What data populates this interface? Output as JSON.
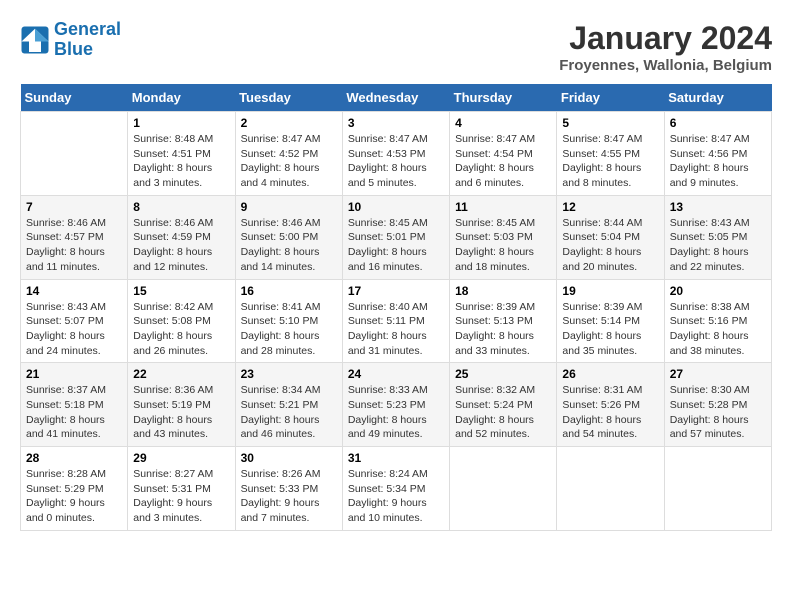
{
  "header": {
    "logo_line1": "General",
    "logo_line2": "Blue",
    "month_year": "January 2024",
    "location": "Froyennes, Wallonia, Belgium"
  },
  "weekdays": [
    "Sunday",
    "Monday",
    "Tuesday",
    "Wednesday",
    "Thursday",
    "Friday",
    "Saturday"
  ],
  "weeks": [
    [
      {
        "day": "",
        "info": ""
      },
      {
        "day": "1",
        "info": "Sunrise: 8:48 AM\nSunset: 4:51 PM\nDaylight: 8 hours\nand 3 minutes."
      },
      {
        "day": "2",
        "info": "Sunrise: 8:47 AM\nSunset: 4:52 PM\nDaylight: 8 hours\nand 4 minutes."
      },
      {
        "day": "3",
        "info": "Sunrise: 8:47 AM\nSunset: 4:53 PM\nDaylight: 8 hours\nand 5 minutes."
      },
      {
        "day": "4",
        "info": "Sunrise: 8:47 AM\nSunset: 4:54 PM\nDaylight: 8 hours\nand 6 minutes."
      },
      {
        "day": "5",
        "info": "Sunrise: 8:47 AM\nSunset: 4:55 PM\nDaylight: 8 hours\nand 8 minutes."
      },
      {
        "day": "6",
        "info": "Sunrise: 8:47 AM\nSunset: 4:56 PM\nDaylight: 8 hours\nand 9 minutes."
      }
    ],
    [
      {
        "day": "7",
        "info": "Sunrise: 8:46 AM\nSunset: 4:57 PM\nDaylight: 8 hours\nand 11 minutes."
      },
      {
        "day": "8",
        "info": "Sunrise: 8:46 AM\nSunset: 4:59 PM\nDaylight: 8 hours\nand 12 minutes."
      },
      {
        "day": "9",
        "info": "Sunrise: 8:46 AM\nSunset: 5:00 PM\nDaylight: 8 hours\nand 14 minutes."
      },
      {
        "day": "10",
        "info": "Sunrise: 8:45 AM\nSunset: 5:01 PM\nDaylight: 8 hours\nand 16 minutes."
      },
      {
        "day": "11",
        "info": "Sunrise: 8:45 AM\nSunset: 5:03 PM\nDaylight: 8 hours\nand 18 minutes."
      },
      {
        "day": "12",
        "info": "Sunrise: 8:44 AM\nSunset: 5:04 PM\nDaylight: 8 hours\nand 20 minutes."
      },
      {
        "day": "13",
        "info": "Sunrise: 8:43 AM\nSunset: 5:05 PM\nDaylight: 8 hours\nand 22 minutes."
      }
    ],
    [
      {
        "day": "14",
        "info": "Sunrise: 8:43 AM\nSunset: 5:07 PM\nDaylight: 8 hours\nand 24 minutes."
      },
      {
        "day": "15",
        "info": "Sunrise: 8:42 AM\nSunset: 5:08 PM\nDaylight: 8 hours\nand 26 minutes."
      },
      {
        "day": "16",
        "info": "Sunrise: 8:41 AM\nSunset: 5:10 PM\nDaylight: 8 hours\nand 28 minutes."
      },
      {
        "day": "17",
        "info": "Sunrise: 8:40 AM\nSunset: 5:11 PM\nDaylight: 8 hours\nand 31 minutes."
      },
      {
        "day": "18",
        "info": "Sunrise: 8:39 AM\nSunset: 5:13 PM\nDaylight: 8 hours\nand 33 minutes."
      },
      {
        "day": "19",
        "info": "Sunrise: 8:39 AM\nSunset: 5:14 PM\nDaylight: 8 hours\nand 35 minutes."
      },
      {
        "day": "20",
        "info": "Sunrise: 8:38 AM\nSunset: 5:16 PM\nDaylight: 8 hours\nand 38 minutes."
      }
    ],
    [
      {
        "day": "21",
        "info": "Sunrise: 8:37 AM\nSunset: 5:18 PM\nDaylight: 8 hours\nand 41 minutes."
      },
      {
        "day": "22",
        "info": "Sunrise: 8:36 AM\nSunset: 5:19 PM\nDaylight: 8 hours\nand 43 minutes."
      },
      {
        "day": "23",
        "info": "Sunrise: 8:34 AM\nSunset: 5:21 PM\nDaylight: 8 hours\nand 46 minutes."
      },
      {
        "day": "24",
        "info": "Sunrise: 8:33 AM\nSunset: 5:23 PM\nDaylight: 8 hours\nand 49 minutes."
      },
      {
        "day": "25",
        "info": "Sunrise: 8:32 AM\nSunset: 5:24 PM\nDaylight: 8 hours\nand 52 minutes."
      },
      {
        "day": "26",
        "info": "Sunrise: 8:31 AM\nSunset: 5:26 PM\nDaylight: 8 hours\nand 54 minutes."
      },
      {
        "day": "27",
        "info": "Sunrise: 8:30 AM\nSunset: 5:28 PM\nDaylight: 8 hours\nand 57 minutes."
      }
    ],
    [
      {
        "day": "28",
        "info": "Sunrise: 8:28 AM\nSunset: 5:29 PM\nDaylight: 9 hours\nand 0 minutes."
      },
      {
        "day": "29",
        "info": "Sunrise: 8:27 AM\nSunset: 5:31 PM\nDaylight: 9 hours\nand 3 minutes."
      },
      {
        "day": "30",
        "info": "Sunrise: 8:26 AM\nSunset: 5:33 PM\nDaylight: 9 hours\nand 7 minutes."
      },
      {
        "day": "31",
        "info": "Sunrise: 8:24 AM\nSunset: 5:34 PM\nDaylight: 9 hours\nand 10 minutes."
      },
      {
        "day": "",
        "info": ""
      },
      {
        "day": "",
        "info": ""
      },
      {
        "day": "",
        "info": ""
      }
    ]
  ]
}
